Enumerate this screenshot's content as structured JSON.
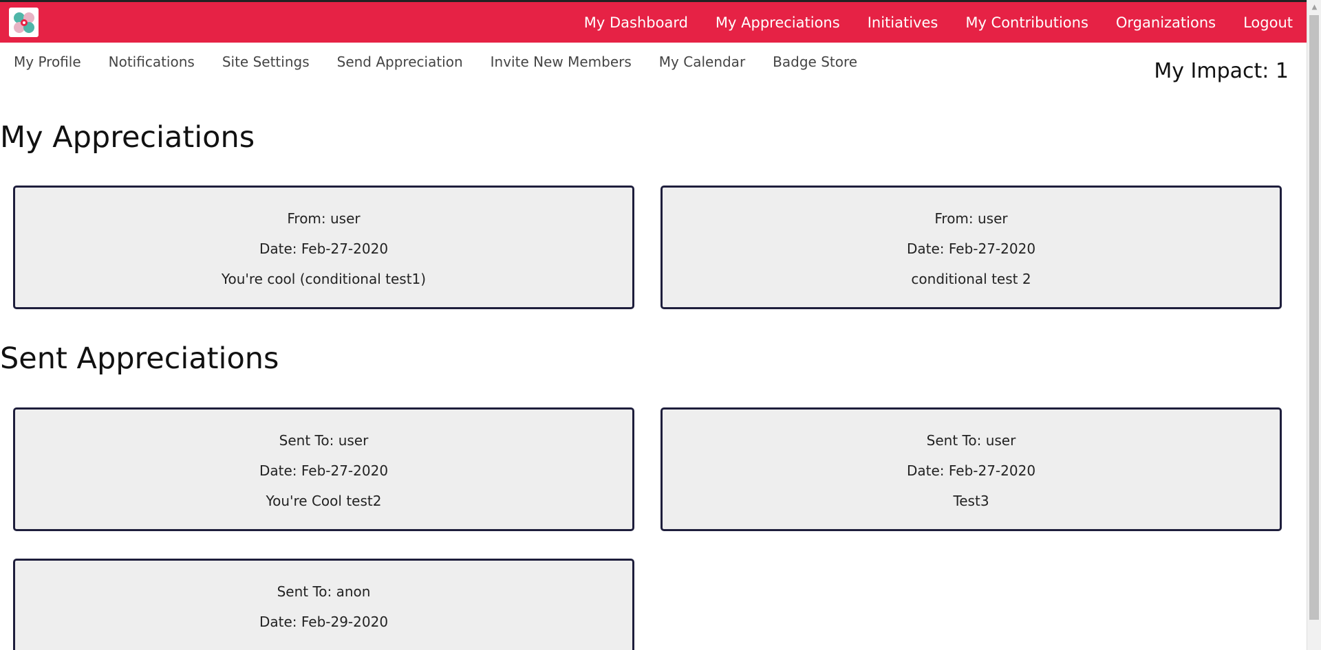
{
  "header": {
    "logo_icon": "clover-logo-icon",
    "nav": [
      {
        "label": "My Dashboard"
      },
      {
        "label": "My Appreciations"
      },
      {
        "label": "Initiatives"
      },
      {
        "label": "My Contributions"
      },
      {
        "label": "Organizations"
      },
      {
        "label": "Logout"
      }
    ],
    "colors": {
      "bar": "#e62245",
      "text": "#ffffff"
    }
  },
  "subnav": [
    {
      "label": "My Profile"
    },
    {
      "label": "Notifications"
    },
    {
      "label": "Site Settings"
    },
    {
      "label": "Send Appreciation"
    },
    {
      "label": "Invite New Members"
    },
    {
      "label": "My Calendar"
    },
    {
      "label": "Badge Store"
    }
  ],
  "impact": "My Impact: 1",
  "received": {
    "title": "My Appreciations",
    "cards": [
      {
        "from": "From: user",
        "date": "Date: Feb-27-2020",
        "message": "You're cool (conditional test1)"
      },
      {
        "from": "From: user",
        "date": "Date: Feb-27-2020",
        "message": "conditional test 2"
      }
    ]
  },
  "sent": {
    "title": "Sent Appreciations",
    "cards": [
      {
        "to": "Sent To: user",
        "date": "Date: Feb-27-2020",
        "message": "You're Cool test2"
      },
      {
        "to": "Sent To: user",
        "date": "Date: Feb-27-2020",
        "message": "Test3"
      },
      {
        "to": "Sent To: anon",
        "date": "Date: Feb-29-2020",
        "message": ""
      }
    ]
  }
}
